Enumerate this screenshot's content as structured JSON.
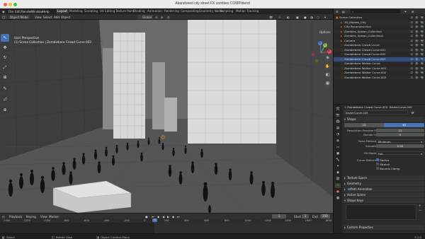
{
  "window": {
    "title": "Abandoned city street FX zombies COMP.blend",
    "traffic_colors": [
      "#ff5f57",
      "#febc2e",
      "#28c840"
    ]
  },
  "menu": {
    "items": [
      "File",
      "Edit",
      "Render",
      "Window",
      "Help"
    ],
    "workspaces": [
      "Layout",
      "Modeling",
      "Sculpting",
      "UV Editing",
      "Texture Paint",
      "Shading",
      "Animation",
      "Rendering",
      "Compositing",
      "Geometry Nodes",
      "Scripting",
      "Motion Tracking"
    ],
    "active_workspace": "Layout",
    "scene": "Scene",
    "view_layer": "ViewLayer"
  },
  "viewport_header": {
    "mode": "Object Mode",
    "menus": [
      "View",
      "Select",
      "Add",
      "Object"
    ],
    "transform": "Global",
    "options": "Options"
  },
  "viewport": {
    "overlay_line1": "User Perspective",
    "overlay_line2": "(1) Scene Collection | Zombiebere Crowd Curve.003",
    "gizmo": {
      "x": "X",
      "y": "Y",
      "z": "Z"
    },
    "bg_color": "#6a6a6a"
  },
  "toolbar": {
    "tools": [
      "↖",
      "✥",
      "↻",
      "⤢",
      "⊞",
      "✎",
      "◿",
      "⊕"
    ]
  },
  "timeline": {
    "menus": [
      "Playback",
      "Keying",
      "View",
      "Marker"
    ],
    "current_frame": "1",
    "start_label": "Start",
    "start": "1",
    "end_label": "End",
    "end": "250",
    "ruler": [
      "-1400",
      "-1200",
      "-1000",
      "-800",
      "-600",
      "-400",
      "-200",
      "0",
      "200",
      "400",
      "600",
      "800",
      "1000",
      "1200",
      "1400",
      "1600",
      "1800"
    ],
    "playhead_frame": "0"
  },
  "outliner": {
    "search_placeholder": "",
    "rows": [
      {
        "label": "Scene Collection",
        "indent": 0,
        "icon": "▣"
      },
      {
        "label": "3D_Models_City",
        "indent": 1,
        "icon": "▸"
      },
      {
        "label": "City Reconstruction",
        "indent": 1,
        "icon": "▸"
      },
      {
        "label": "Zombies_Spawn_Collection",
        "indent": 1,
        "icon": "▸"
      },
      {
        "label": "Zombies_Spawn_Collection2",
        "indent": 1,
        "icon": "▸"
      },
      {
        "label": "Camera",
        "indent": 1,
        "icon": "▸"
      },
      {
        "label": "Zombiebere Crowd Curve",
        "indent": 1,
        "icon": "◌"
      },
      {
        "label": "Zombiebere Crowd Curve.001",
        "indent": 1,
        "icon": "◌"
      },
      {
        "label": "Zombiebere Crowd Curve.002",
        "indent": 1,
        "icon": "◌"
      },
      {
        "label": "Zombiebere Crowd Curve.003",
        "indent": 1,
        "icon": "◌"
      },
      {
        "label": "Zombiebere Walker Curve",
        "indent": 1,
        "icon": "◌"
      },
      {
        "label": "Zombiebere Walker Curve.001",
        "indent": 1,
        "icon": "◌"
      },
      {
        "label": "Zombiebere Walker Curve.002",
        "indent": 1,
        "icon": "◌"
      },
      {
        "label": "Zombiebere Walker Curve.003",
        "indent": 1,
        "icon": "◌"
      }
    ],
    "selected_index": 9
  },
  "properties": {
    "breadcrumb_object": "Zombiebere Crowd Curve.003",
    "breadcrumb_data": "BezierCurve.009",
    "datablock": "BezierCurve.009",
    "shape": {
      "title": "Shape",
      "dim_2d": "2D",
      "dim_3d": "3D",
      "res_preview_label": "Resolution Preview U",
      "res_preview": "12",
      "render_u_label": "Render U",
      "render_u": "0",
      "twist_method_label": "Twist Method",
      "twist_method": "Minimum",
      "smooth_label": "Smooth",
      "smooth": "0.00",
      "fill_mode_label": "Fill Mode",
      "fill_mode": "Full",
      "curve_deform_label": "Curve Deform",
      "radius": "Radius",
      "stretch": "Stretch",
      "bounds_clamp": "Bounds Clamp"
    },
    "sections": [
      "Texture Space",
      "Geometry",
      "Path Animation",
      "Active Spline",
      "Shape Keys",
      "Custom Properties"
    ],
    "accent": "#4772b3"
  },
  "statusbar": {
    "left": "Select",
    "middle": "Rotate View",
    "right": "Object Context Menu",
    "version": "3.2.0"
  }
}
